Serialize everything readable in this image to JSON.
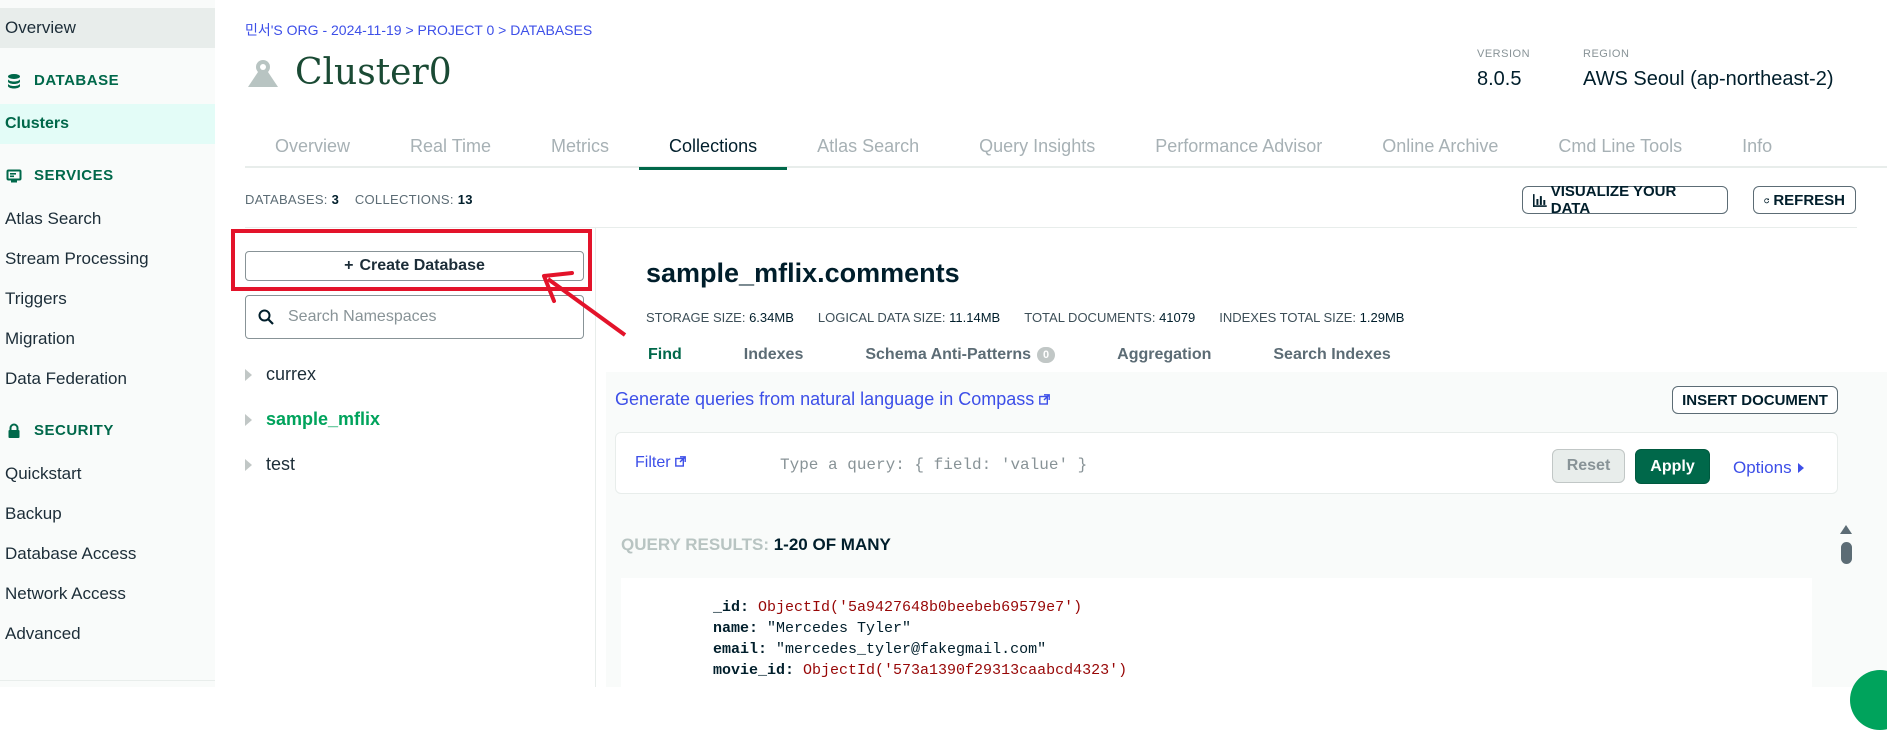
{
  "sidebar": {
    "overview": "Overview",
    "database_section": "DATABASE",
    "clusters": "Clusters",
    "services_section": "SERVICES",
    "services_items": [
      "Atlas Search",
      "Stream Processing",
      "Triggers",
      "Migration",
      "Data Federation"
    ],
    "security_section": "SECURITY",
    "security_items": [
      "Quickstart",
      "Backup",
      "Database Access",
      "Network Access",
      "Advanced"
    ]
  },
  "header": {
    "breadcrumb": "민서'S ORG - 2024-11-19 > PROJECT 0 > DATABASES",
    "cluster_name": "Cluster0",
    "version_label": "VERSION",
    "version_value": "8.0.5",
    "region_label": "REGION",
    "region_value": "AWS Seoul (ap-northeast-2)"
  },
  "tabs": [
    "Overview",
    "Real Time",
    "Metrics",
    "Collections",
    "Atlas Search",
    "Query Insights",
    "Performance Advisor",
    "Online Archive",
    "Cmd Line Tools",
    "Info"
  ],
  "active_tab": "Collections",
  "counts": {
    "databases_label": "DATABASES:",
    "databases_value": "3",
    "collections_label": "COLLECTIONS:",
    "collections_value": "13"
  },
  "toolbar": {
    "visualize": "VISUALIZE YOUR DATA",
    "refresh": "REFRESH"
  },
  "left_panel": {
    "create_db": "Create Database",
    "search_placeholder": "Search Namespaces",
    "databases": [
      "currex",
      "sample_mflix",
      "test"
    ]
  },
  "collection": {
    "title": "sample_mflix.comments",
    "storage_label": "STORAGE SIZE:",
    "storage_value": "6.34MB",
    "logical_label": "LOGICAL DATA SIZE:",
    "logical_value": "11.14MB",
    "docs_label": "TOTAL DOCUMENTS:",
    "docs_value": "41079",
    "indexes_label": "INDEXES TOTAL SIZE:",
    "indexes_value": "1.29MB",
    "sub_tabs": [
      "Find",
      "Indexes",
      "Schema Anti-Patterns",
      "Aggregation",
      "Search Indexes"
    ],
    "anti_patterns_count": "0"
  },
  "find": {
    "nl_link": "Generate queries from natural language in Compass",
    "insert_doc": "INSERT DOCUMENT",
    "filter_label": "Filter",
    "filter_placeholder": "Type a query: { field: 'value' }",
    "reset": "Reset",
    "apply": "Apply",
    "options": "Options"
  },
  "results": {
    "label": "QUERY RESULTS:",
    "range": "1-20 OF MANY",
    "document": [
      {
        "key": "_id:",
        "value": "ObjectId('5a9427648b0beebeb69579e7')",
        "type": "oid"
      },
      {
        "key": "name:",
        "value": "\"Mercedes Tyler\"",
        "type": "str"
      },
      {
        "key": "email:",
        "value": "\"mercedes_tyler@fakegmail.com\"",
        "type": "str"
      },
      {
        "key": "movie_id:",
        "value": "ObjectId('573a1390f29313caabcd4323')",
        "type": "oid"
      }
    ]
  },
  "colors": {
    "accent_green": "#00684a",
    "link_blue": "#3d4fe8",
    "annotation_red": "#e3132a"
  }
}
